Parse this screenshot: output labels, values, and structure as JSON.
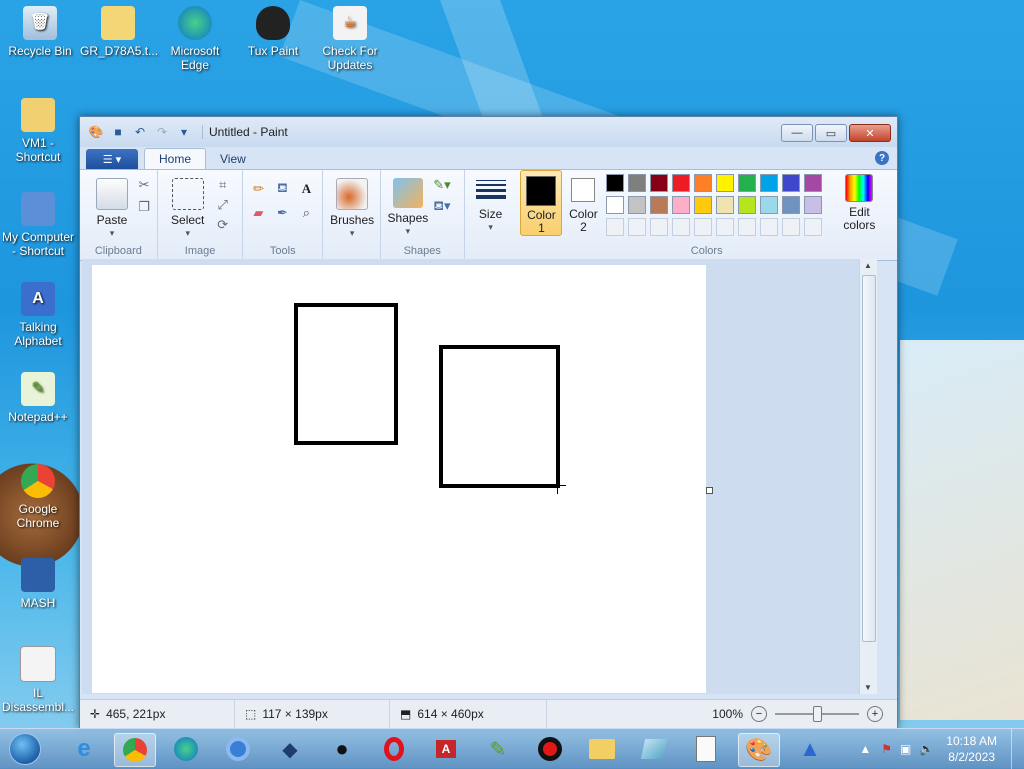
{
  "desktop": {
    "icons": [
      {
        "label": "Recycle Bin"
      },
      {
        "label": "GR_D78A5.t..."
      },
      {
        "label": "Microsoft Edge"
      },
      {
        "label": "Tux Paint"
      },
      {
        "label": "Check For Updates"
      },
      {
        "label": "VM1 - Shortcut"
      },
      {
        "label": "My Computer - Shortcut"
      },
      {
        "label": "Talking Alphabet"
      },
      {
        "label": "Notepad++"
      },
      {
        "label": "Google Chrome"
      },
      {
        "label": "MASH"
      },
      {
        "label": "IL Disassembl..."
      }
    ]
  },
  "window": {
    "title": "Untitled - Paint",
    "tabs": [
      {
        "label": "Home"
      },
      {
        "label": "View"
      }
    ],
    "ribbon": {
      "clipboard": {
        "paste": "Paste",
        "group": "Clipboard"
      },
      "image": {
        "select": "Select",
        "group": "Image"
      },
      "tools": {
        "group": "Tools"
      },
      "brushes": {
        "label": "Brushes"
      },
      "shapes": {
        "label": "Shapes",
        "group": "Shapes"
      },
      "size": {
        "label": "Size"
      },
      "color1": {
        "label1": "Color",
        "label2": "1",
        "value": "#000000"
      },
      "color2": {
        "label1": "Color",
        "label2": "2",
        "value": "#ffffff"
      },
      "colors_group": "Colors",
      "edit_colors": {
        "label1": "Edit",
        "label2": "colors"
      },
      "palette_row1": [
        "#000000",
        "#7f7f7f",
        "#880015",
        "#ed1c24",
        "#ff7f27",
        "#fff200",
        "#22b14c",
        "#00a2e8",
        "#3f48cc",
        "#a349a4"
      ],
      "palette_row2": [
        "#ffffff",
        "#c3c3c3",
        "#b97a57",
        "#ffaec9",
        "#ffc90e",
        "#efe4b0",
        "#b5e61d",
        "#99d9ea",
        "#7092be",
        "#c8bfe7"
      ]
    },
    "status": {
      "cursor_pos": "465, 221px",
      "selection_size": "117 × 139px",
      "canvas_size": "614 × 460px",
      "zoom": "100%"
    }
  },
  "taskbar": {
    "time": "10:18 AM",
    "date": "8/2/2023"
  }
}
